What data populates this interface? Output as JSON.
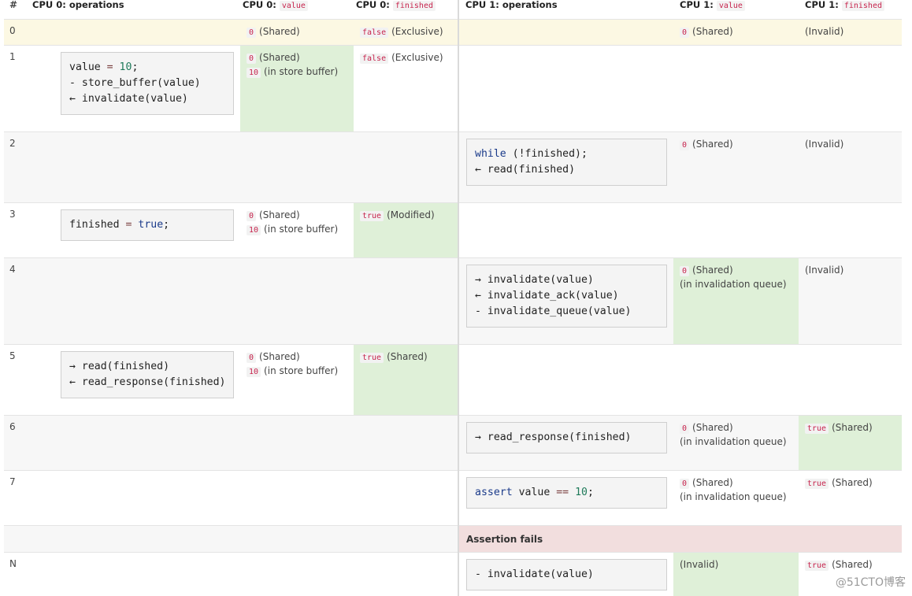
{
  "header": {
    "num": "#",
    "cpu0_ops": "CPU 0: operations",
    "cpu0_value_prefix": "CPU 0:",
    "cpu0_value_var": "value",
    "cpu0_finished_prefix": "CPU 0:",
    "cpu0_finished_var": "finished",
    "cpu1_ops": "CPU 1: operations",
    "cpu1_value_prefix": "CPU 1:",
    "cpu1_value_var": "value",
    "cpu1_finished_prefix": "CPU 1:",
    "cpu1_finished_var": "finished"
  },
  "rows": [
    {
      "num": "0",
      "c0v": [
        {
          "tag": "0",
          "text": "(Shared)"
        }
      ],
      "c0f": [
        {
          "tag": "false",
          "text": "(Exclusive)"
        }
      ],
      "c1v": [
        {
          "tag": "0",
          "text": "(Shared)"
        }
      ],
      "c1f": [
        {
          "tag": "",
          "text": "(Invalid)"
        }
      ]
    },
    {
      "num": "1",
      "op0": [
        "value = 10;",
        "- store_buffer(value)",
        "← invalidate(value)"
      ],
      "c0v": [
        {
          "tag": "0",
          "text": "(Shared)"
        },
        {
          "tag": "10",
          "text": "(in store buffer)"
        }
      ],
      "c0f": [
        {
          "tag": "false",
          "text": "(Exclusive)"
        }
      ]
    },
    {
      "num": "2",
      "op1": [
        "while (!finished);",
        "← read(finished)"
      ],
      "c1v": [
        {
          "tag": "0",
          "text": "(Shared)"
        }
      ],
      "c1f": [
        {
          "tag": "",
          "text": "(Invalid)"
        }
      ]
    },
    {
      "num": "3",
      "op0": [
        "finished = true;"
      ],
      "c0v": [
        {
          "tag": "0",
          "text": "(Shared)"
        },
        {
          "tag": "10",
          "text": "(in store buffer)"
        }
      ],
      "c0f": [
        {
          "tag": "true",
          "text": "(Modified)"
        }
      ]
    },
    {
      "num": "4",
      "op1": [
        "→ invalidate(value)",
        "← invalidate_ack(value)",
        "- invalidate_queue(value)"
      ],
      "c1v": [
        {
          "tag": "0",
          "text": "(Shared)"
        },
        {
          "tag": "",
          "text": "(in invalidation queue)"
        }
      ],
      "c1f": [
        {
          "tag": "",
          "text": "(Invalid)"
        }
      ]
    },
    {
      "num": "5",
      "op0": [
        "→ read(finished)",
        "← read_response(finished)"
      ],
      "c0v": [
        {
          "tag": "0",
          "text": "(Shared)"
        },
        {
          "tag": "10",
          "text": "(in store buffer)"
        }
      ],
      "c0f": [
        {
          "tag": "true",
          "text": "(Shared)"
        }
      ]
    },
    {
      "num": "6",
      "op1": [
        "→ read_response(finished)"
      ],
      "c1v": [
        {
          "tag": "0",
          "text": "(Shared)"
        },
        {
          "tag": "",
          "text": "(in invalidation queue)"
        }
      ],
      "c1f": [
        {
          "tag": "true",
          "text": "(Shared)"
        }
      ]
    },
    {
      "num": "7",
      "op1": [
        "assert value == 10;"
      ],
      "c1v": [
        {
          "tag": "0",
          "text": "(Shared)"
        },
        {
          "tag": "",
          "text": "(in invalidation queue)"
        }
      ],
      "c1f": [
        {
          "tag": "true",
          "text": "(Shared)"
        }
      ]
    },
    {
      "assert_label": "Assertion fails"
    },
    {
      "num": "N",
      "op1": [
        "- invalidate(value)"
      ],
      "c1v": [
        {
          "tag": "",
          "text": "(Invalid)"
        }
      ],
      "c1f": [
        {
          "tag": "true",
          "text": "(Shared)"
        }
      ]
    }
  ],
  "colors": {
    "modified_cell": "#dff0d8",
    "highlight_row": "#fcf8e3",
    "assertion_row": "#f2dede",
    "tag_text": "#c7254e"
  },
  "watermark": "@51CTO博客"
}
